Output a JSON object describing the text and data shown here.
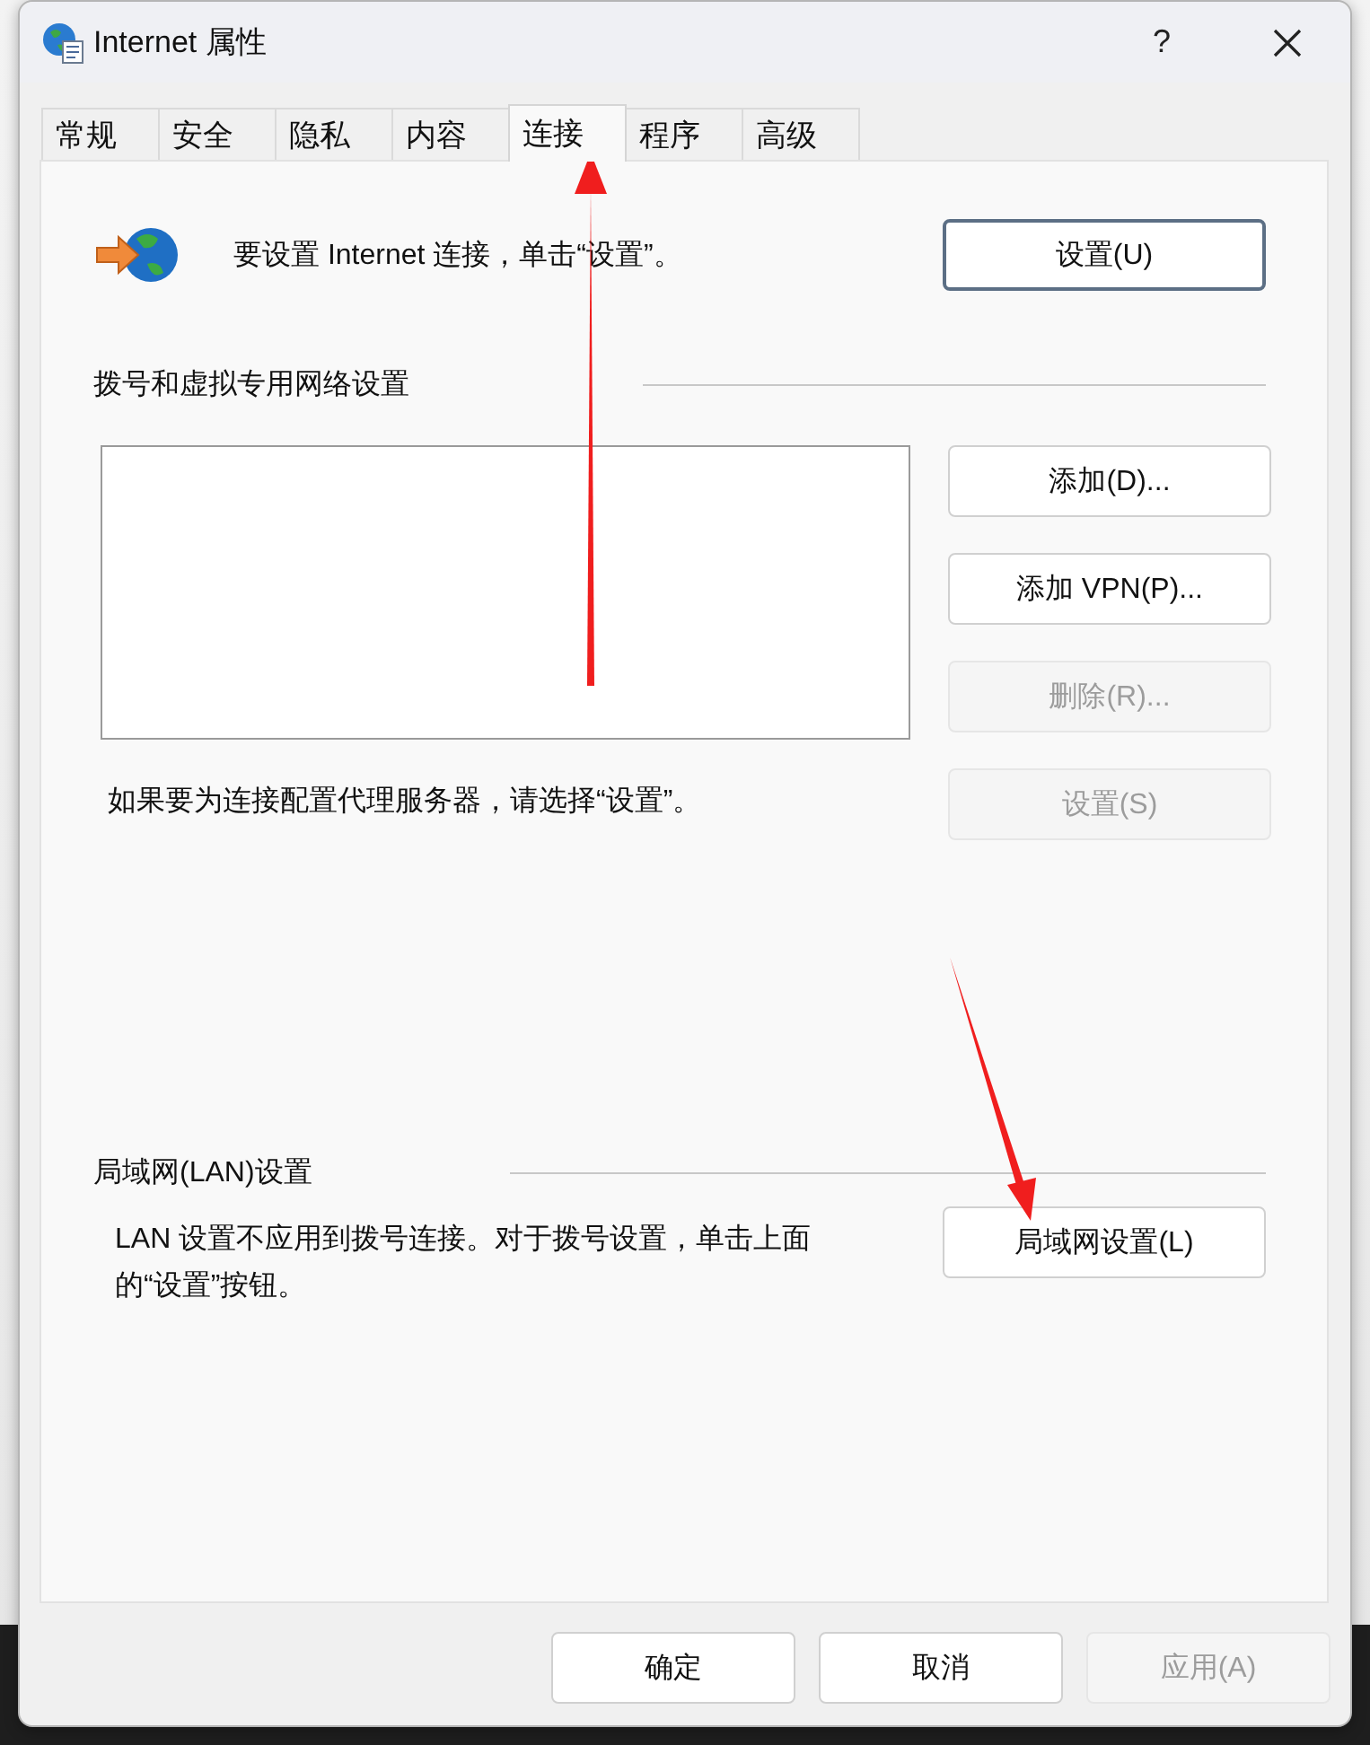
{
  "window": {
    "title": "Internet 属性",
    "help": "?"
  },
  "tabs": [
    {
      "label": "常规",
      "selected": false
    },
    {
      "label": "安全",
      "selected": false
    },
    {
      "label": "隐私",
      "selected": false
    },
    {
      "label": "内容",
      "selected": false
    },
    {
      "label": "连接",
      "selected": true
    },
    {
      "label": "程序",
      "selected": false
    },
    {
      "label": "高级",
      "selected": false
    }
  ],
  "setup": {
    "text": "要设置 Internet 连接，单击“设置”。",
    "button": {
      "label": "设置(U)",
      "focused": true
    }
  },
  "dialup": {
    "heading": "拨号和虚拟专用网络设置",
    "buttons": [
      {
        "label": "添加(D)...",
        "disabled": false
      },
      {
        "label": "添加 VPN(P)...",
        "disabled": false
      },
      {
        "label": "删除(R)...",
        "disabled": true
      },
      {
        "label": "设置(S)",
        "disabled": true
      }
    ],
    "proxy_text": "如果要为连接配置代理服务器，请选择“设置”。"
  },
  "lan": {
    "heading": "局域网(LAN)设置",
    "text": "LAN 设置不应用到拨号连接。对于拨号设置，单击上面的“设置”按钮。",
    "button": {
      "label": "局域网设置(L)",
      "disabled": false
    }
  },
  "footer_buttons": [
    {
      "label": "确定",
      "disabled": false
    },
    {
      "label": "取消",
      "disabled": false
    },
    {
      "label": "应用(A)",
      "disabled": true
    }
  ]
}
